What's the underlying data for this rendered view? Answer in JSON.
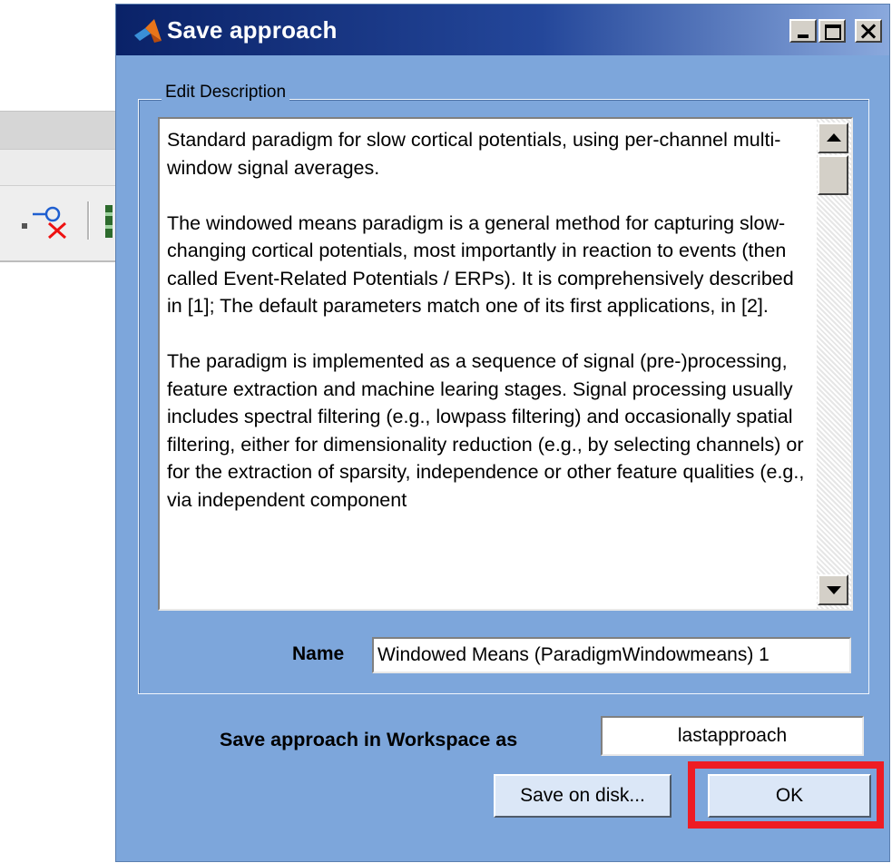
{
  "window": {
    "title": "Save approach",
    "controls": {
      "minimize": "",
      "maximize": "",
      "close": ""
    }
  },
  "description_group": {
    "label": "Edit Description",
    "paragraphs": [
      "Standard paradigm for slow cortical potentials, using per-channel multi-window signal averages.",
      "The windowed means paradigm is a general method for capturing slow-changing cortical potentials, most importantly in reaction to events (then called Event-Related Potentials / ERPs). It is comprehensively described in [1]; The default parameters match one of its first applications, in [2].",
      "The paradigm is implemented as a sequence of signal (pre-)processing, feature extraction and machine learing stages. Signal processing usually includes spectral filtering (e.g., lowpass filtering) and occasionally spatial filtering, either for dimensionality reduction (e.g., by selecting channels) or for the extraction of sparsity, independence or other feature qualities (e.g., via independent component"
    ]
  },
  "name_field": {
    "label": "Name",
    "value": "Windowed Means (ParadigmWindowmeans) 1"
  },
  "workspace_field": {
    "label": "Save approach in Workspace as",
    "value": "lastapproach"
  },
  "buttons": {
    "save_on_disk": "Save on disk...",
    "ok": "OK"
  },
  "icons": {
    "title_logo": "matlab-logo-icon",
    "background_tool": "remove-marker-icon"
  },
  "colors": {
    "dialog_bg": "#7da6db",
    "highlight": "#ee1c24",
    "title_gradient_start": "#0a2268"
  }
}
